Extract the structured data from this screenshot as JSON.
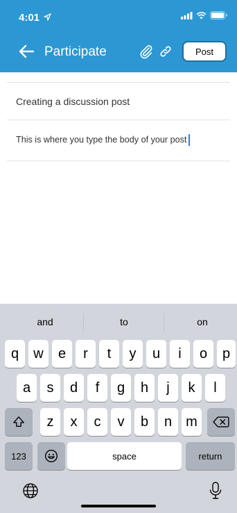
{
  "status_bar": {
    "time": "4:01"
  },
  "app_bar": {
    "title": "Participate",
    "post_label": "Post"
  },
  "compose": {
    "subject": "Creating a discussion post",
    "body": "This is where you type the body of your post"
  },
  "keyboard": {
    "suggestions": [
      "and",
      "to",
      "on"
    ],
    "row1": [
      "q",
      "w",
      "e",
      "r",
      "t",
      "y",
      "u",
      "i",
      "o",
      "p"
    ],
    "row2": [
      "a",
      "s",
      "d",
      "f",
      "g",
      "h",
      "j",
      "k",
      "l"
    ],
    "row3": [
      "z",
      "x",
      "c",
      "v",
      "b",
      "n",
      "m"
    ],
    "numbers_label": "123",
    "space_label": "space",
    "return_label": "return"
  },
  "colors": {
    "header": "#2c97d3",
    "cursor": "#3478f6",
    "keyboard_bg": "#d2d5db"
  },
  "icons": [
    "location-arrow-icon",
    "signal-icon",
    "wifi-icon",
    "battery-icon",
    "back-arrow-icon",
    "paperclip-icon",
    "link-icon",
    "shift-icon",
    "backspace-icon",
    "emoji-icon",
    "globe-icon",
    "microphone-icon"
  ]
}
